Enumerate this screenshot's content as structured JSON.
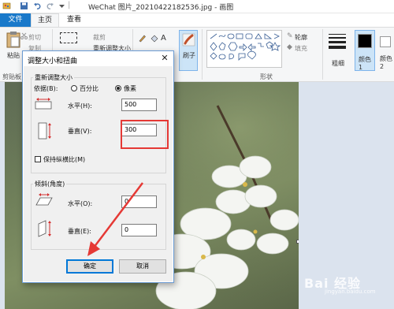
{
  "titlebar": {
    "title": "WeChat 图片_20210422182536.jpg - 画图",
    "icons": [
      "paint-app-icon",
      "save-icon",
      "undo-icon",
      "redo-icon",
      "customize-qat-icon"
    ]
  },
  "tabs": {
    "file": "文件",
    "home": "主页",
    "view": "查看"
  },
  "ribbon": {
    "clipboard": {
      "paste": "粘贴",
      "cut": "剪切",
      "copy": "复制",
      "group_label": "剪贴板"
    },
    "image": {
      "crop": "裁剪",
      "resize": "重新调整大小"
    },
    "tools": {
      "brushes": "刷子"
    },
    "shapes": {
      "outline": "轮廓",
      "fill": "填充",
      "group_label": "形状"
    },
    "size": {
      "label": "粗细"
    },
    "colors": {
      "color1": "颜色 1",
      "color2": "颜色 2",
      "color1_hex": "#000000",
      "color2_hex": "#ffffff"
    }
  },
  "dialog": {
    "title": "调整大小和扭曲",
    "close_glyph": "✕",
    "resize": {
      "legend": "重新调整大小",
      "by_label": "依据(B):",
      "percent_label": "百分比",
      "pixels_label": "像素",
      "selected": "像素",
      "horizontal_label": "水平(H):",
      "horizontal_value": "500",
      "vertical_label": "垂直(V):",
      "vertical_value": "300",
      "keep_ratio_label": "保持纵横比(M)",
      "keep_ratio_checked": false
    },
    "skew": {
      "legend": "倾斜(角度)",
      "horizontal_label": "水平(O):",
      "horizontal_value": "0",
      "vertical_label": "垂直(E):",
      "vertical_value": "0"
    },
    "ok_label": "确定",
    "cancel_label": "取消"
  },
  "watermark": {
    "text": "Bai 经验",
    "sub": "jingyan.baidu.com"
  },
  "colors": {
    "accent": "#1979ca",
    "highlight": "#e53935",
    "focus": "#0078d7"
  }
}
